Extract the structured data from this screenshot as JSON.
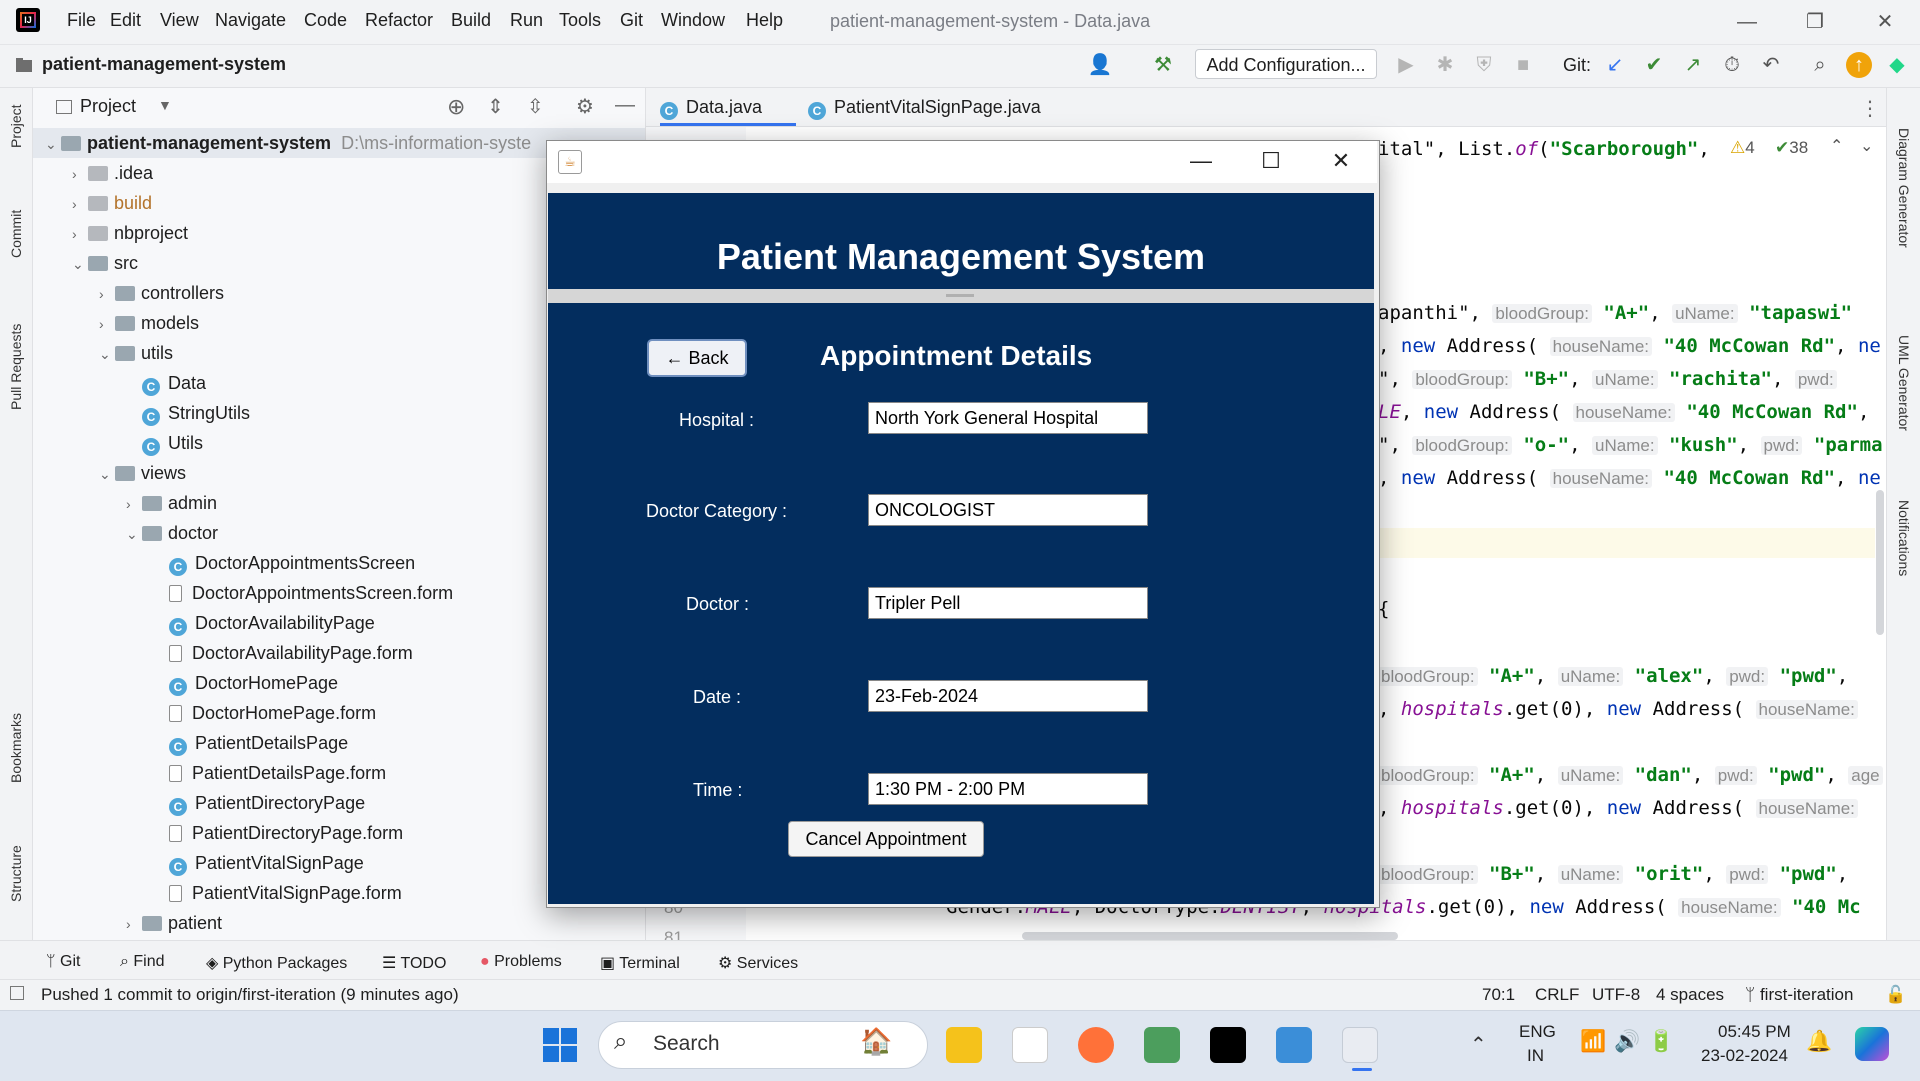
{
  "menubar": {
    "items": [
      "File",
      "Edit",
      "View",
      "Navigate",
      "Code",
      "Refactor",
      "Build",
      "Run",
      "Tools",
      "Git",
      "Window",
      "Help"
    ],
    "window_title": "patient-management-system - Data.java"
  },
  "toolbar": {
    "project_name": "patient-management-system",
    "run_config": "Add Configuration...",
    "git_label": "Git:"
  },
  "left_strip": {
    "project": "Project",
    "commit": "Commit",
    "pull_requests": "Pull Requests",
    "bookmarks": "Bookmarks",
    "structure": "Structure"
  },
  "right_strip": {
    "diagram": "Diagram Generator",
    "uml": "UML Generator",
    "notifications": "Notifications"
  },
  "project_panel": {
    "title": "Project",
    "tree": [
      {
        "label": "patient-management-system",
        "path": "D:\\ms-information-syste",
        "kind": "root"
      },
      {
        "label": ".idea",
        "kind": "folder"
      },
      {
        "label": "build",
        "kind": "folder"
      },
      {
        "label": "nbproject",
        "kind": "folder"
      },
      {
        "label": "src",
        "kind": "folder"
      },
      {
        "label": "controllers",
        "kind": "package"
      },
      {
        "label": "models",
        "kind": "package"
      },
      {
        "label": "utils",
        "kind": "package"
      },
      {
        "label": "Data",
        "kind": "class"
      },
      {
        "label": "StringUtils",
        "kind": "class"
      },
      {
        "label": "Utils",
        "kind": "class"
      },
      {
        "label": "views",
        "kind": "package"
      },
      {
        "label": "admin",
        "kind": "package"
      },
      {
        "label": "doctor",
        "kind": "package"
      },
      {
        "label": "DoctorAppointmentsScreen",
        "kind": "class"
      },
      {
        "label": "DoctorAppointmentsScreen.form",
        "kind": "form"
      },
      {
        "label": "DoctorAvailabilityPage",
        "kind": "class"
      },
      {
        "label": "DoctorAvailabilityPage.form",
        "kind": "form"
      },
      {
        "label": "DoctorHomePage",
        "kind": "class"
      },
      {
        "label": "DoctorHomePage.form",
        "kind": "form"
      },
      {
        "label": "PatientDetailsPage",
        "kind": "class"
      },
      {
        "label": "PatientDetailsPage.form",
        "kind": "form"
      },
      {
        "label": "PatientDirectoryPage",
        "kind": "class"
      },
      {
        "label": "PatientDirectoryPage.form",
        "kind": "form"
      },
      {
        "label": "PatientVitalSignPage",
        "kind": "class"
      },
      {
        "label": "PatientVitalSignPage.form",
        "kind": "form"
      },
      {
        "label": "patient",
        "kind": "package"
      }
    ]
  },
  "editor": {
    "tabs": [
      {
        "label": "Data.java",
        "active": true
      },
      {
        "label": "PatientVitalSignPage.java",
        "active": false
      }
    ],
    "warnings": "4",
    "checks": "38",
    "line_numbers": [
      "80",
      "81"
    ]
  },
  "dialog": {
    "header_title": "Patient Management System",
    "back_label": "← Back",
    "section_title": "Appointment Details",
    "fields": [
      {
        "label": "Hospital :",
        "value": "North York General Hospital"
      },
      {
        "label": "Doctor Category :",
        "value": "ONCOLOGIST"
      },
      {
        "label": "Doctor :",
        "value": "Tripler Pell"
      },
      {
        "label": "Date :",
        "value": "23-Feb-2024"
      },
      {
        "label": "Time :",
        "value": "1:30 PM - 2:00 PM"
      }
    ],
    "cancel_label": "Cancel Appointment",
    "colors": {
      "header_bg": "#032d5e",
      "body_bg": "#032d5e"
    }
  },
  "bottom_bar": {
    "items": [
      "Git",
      "Find",
      "Python Packages",
      "TODO",
      "Problems",
      "Terminal",
      "Services"
    ]
  },
  "status_bar": {
    "message": "Pushed 1 commit to origin/first-iteration (9 minutes ago)",
    "position": "70:1",
    "line_sep": "CRLF",
    "encoding": "UTF-8",
    "indent": "4 spaces",
    "branch": "first-iteration"
  },
  "taskbar": {
    "search_placeholder": "Search",
    "lang_top": "ENG",
    "lang_bottom": "IN",
    "time": "05:45 PM",
    "date": "23-02-2024"
  }
}
